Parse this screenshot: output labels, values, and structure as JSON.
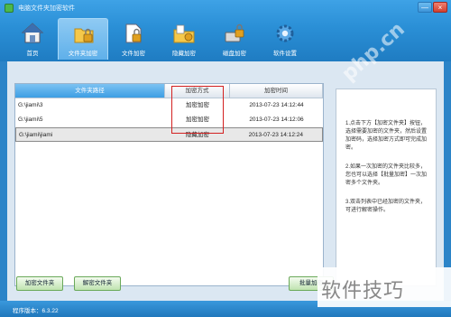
{
  "window": {
    "title": "电脑文件夹加密软件",
    "minimize_icon": "minimize-icon",
    "close_icon": "close-icon",
    "min_glyph": "—",
    "close_glyph": "×"
  },
  "toolbar": {
    "items": [
      {
        "label": "首页",
        "icon": "house-icon"
      },
      {
        "label": "文件夹加密",
        "icon": "folder-lock-icon"
      },
      {
        "label": "文件加密",
        "icon": "file-lock-icon"
      },
      {
        "label": "隐藏加密",
        "icon": "hidden-lock-icon"
      },
      {
        "label": "磁盘加密",
        "icon": "disk-lock-icon"
      },
      {
        "label": "软件设置",
        "icon": "gear-icon"
      }
    ],
    "active_index": 1
  },
  "table": {
    "headers": [
      "文件夹路径",
      "加密方式",
      "加密时间"
    ],
    "rows": [
      {
        "path": "G:\\jiami\\3",
        "method": "加密加密",
        "time": "2013-07-23 14:12:44"
      },
      {
        "path": "G:\\jiami\\5",
        "method": "加密加密",
        "time": "2013-07-23 14:12:06"
      },
      {
        "path": "G:\\jiami\\jiami",
        "method": "隐藏加密",
        "time": "2013-07-23 14:12:24"
      }
    ],
    "selected_row": 2
  },
  "help": {
    "p1": "1.点击下方【加密文件夹】按钮，选择需要加密的文件夹，然后设置加密码，选择加密方式即可完成加密。",
    "p2": "2.如果一次加密的文件夹比较多，您也可以选择【批量加密】一次加密多个文件夹。",
    "p3": "3.双击列表中已经加密的文件夹，可进行解密操作。"
  },
  "buttons": {
    "add": "加密文件夹",
    "unlock": "解密文件夹",
    "batch": "批量加密"
  },
  "status": {
    "label": "程序版本：",
    "version": "6.3.22"
  },
  "watermarks": {
    "site": "php.cn",
    "brand": "软件技巧"
  },
  "colors": {
    "titlebar": "#2a8fd6",
    "active_tab": "#5fb0ea",
    "highlight_box": "#d32020"
  }
}
